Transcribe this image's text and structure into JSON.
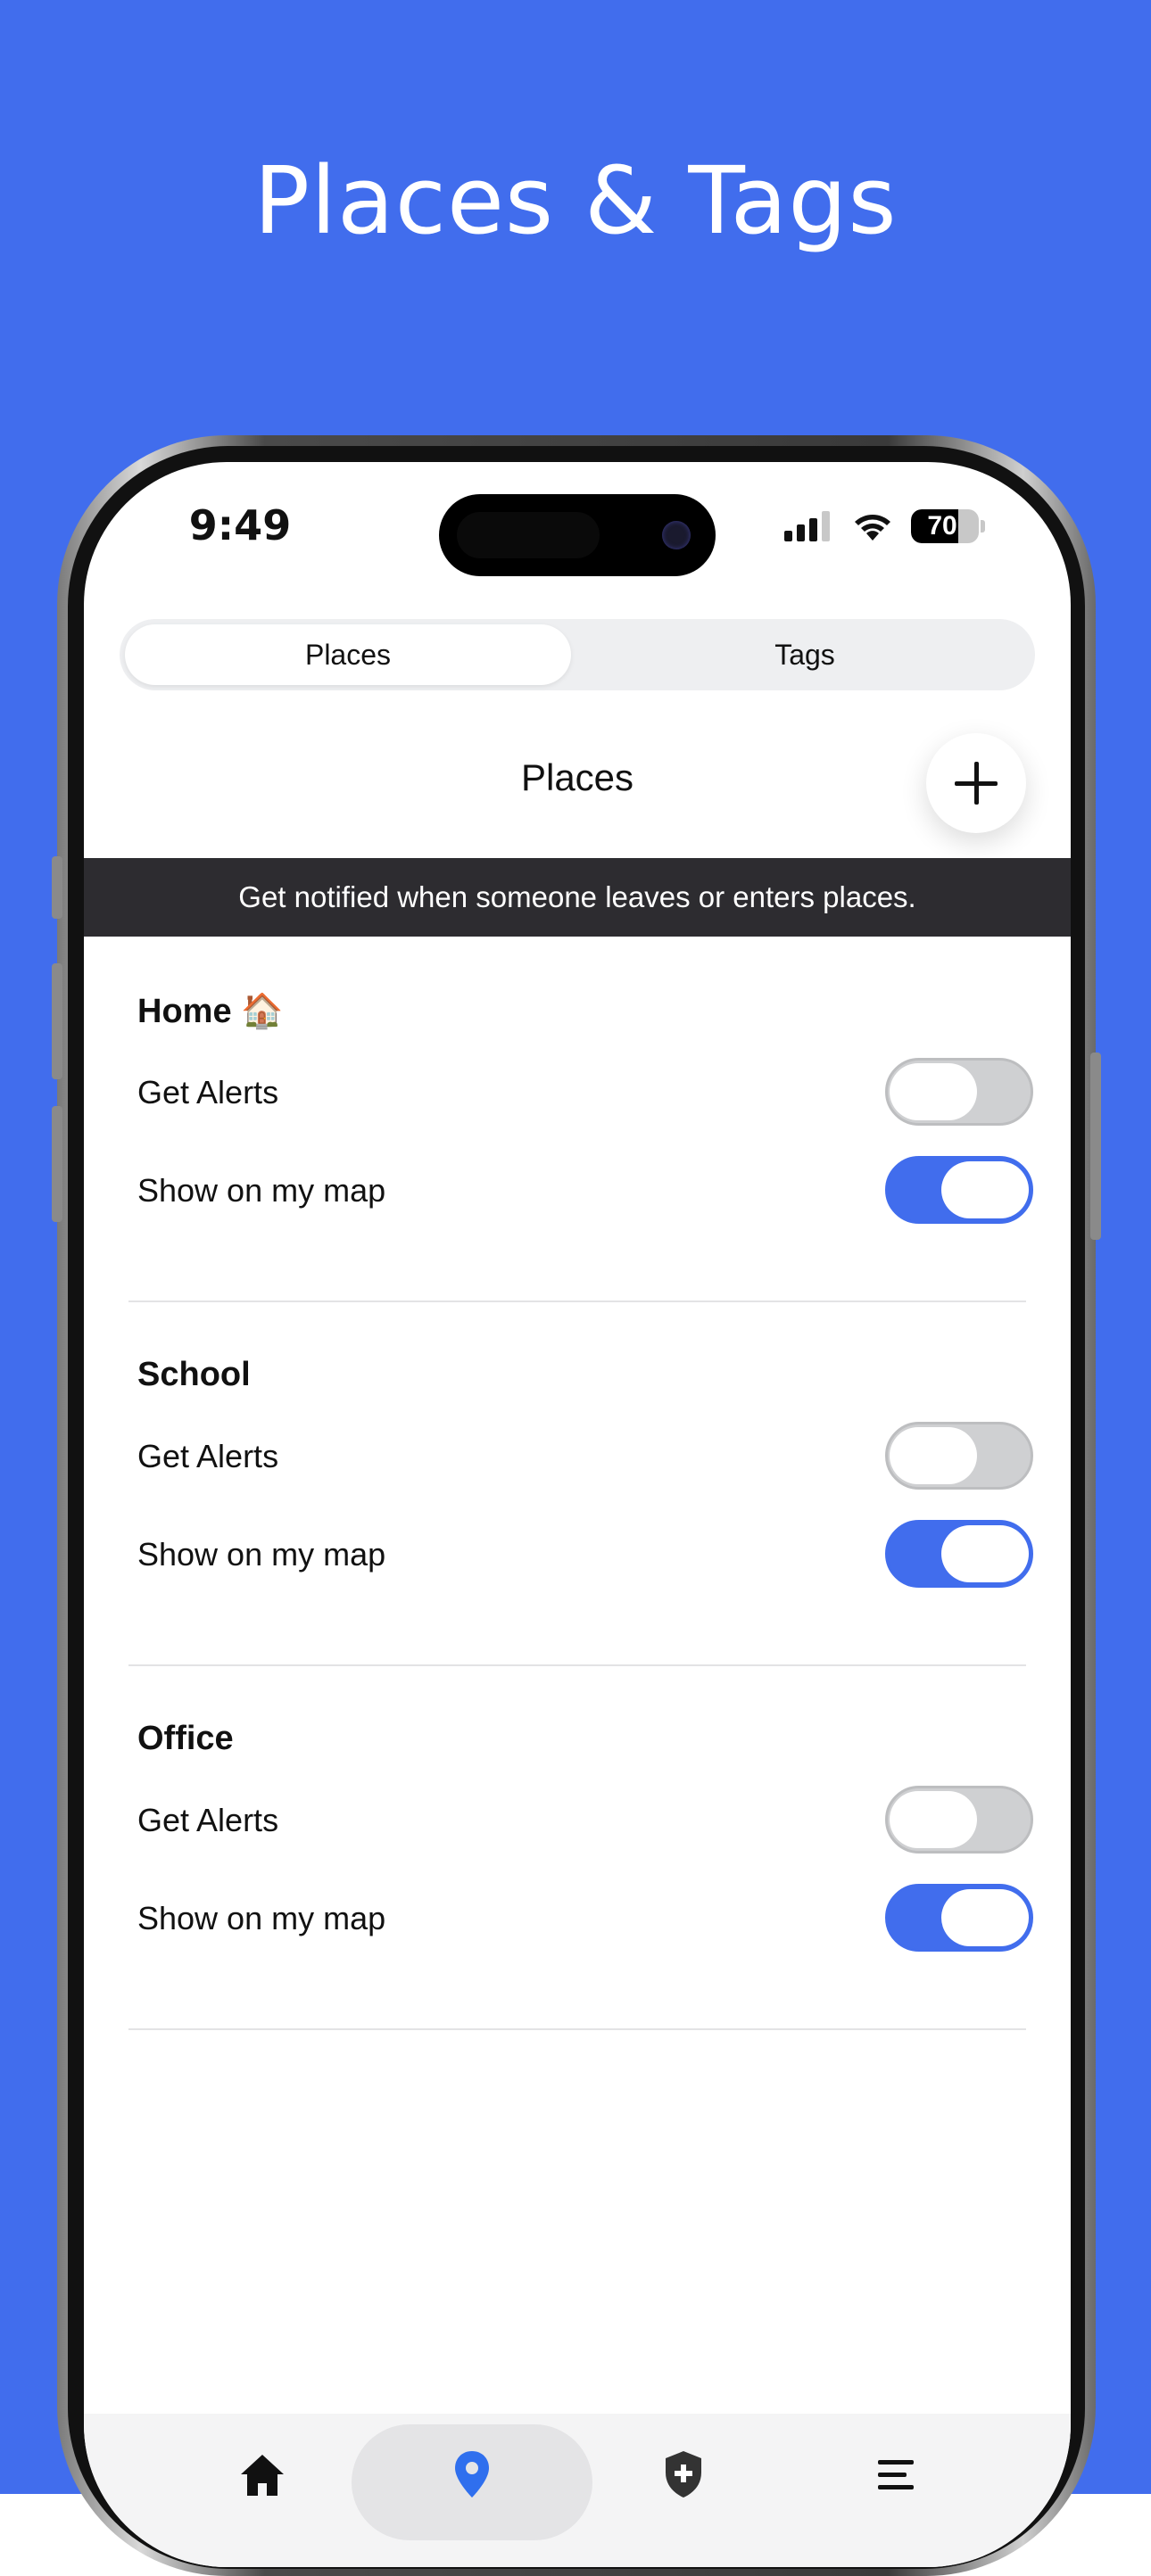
{
  "headline": "Places & Tags",
  "status_bar": {
    "time": "9:49",
    "battery_percent": "70",
    "battery_level": 0.7
  },
  "segmented": {
    "active": "Places",
    "inactive": "Tags"
  },
  "page_title": "Places",
  "add_button_icon": "plus-icon",
  "banner_text": "Get notified when someone leaves or enters places.",
  "places": [
    {
      "name": "Home 🏠",
      "alerts_label": "Get Alerts",
      "alerts_on": false,
      "map_label": "Show on my map",
      "map_on": true
    },
    {
      "name": "School",
      "alerts_label": "Get Alerts",
      "alerts_on": false,
      "map_label": "Show on my map",
      "map_on": true
    },
    {
      "name": "Office",
      "alerts_label": "Get Alerts",
      "alerts_on": false,
      "map_label": "Show on my map",
      "map_on": true
    }
  ],
  "bottom_nav": [
    {
      "icon": "home-icon",
      "active": false
    },
    {
      "icon": "location-pin-icon",
      "active": true
    },
    {
      "icon": "shield-plus-icon",
      "active": false
    },
    {
      "icon": "menu-icon",
      "active": false
    }
  ],
  "colors": {
    "brand_blue": "#416ded",
    "banner_bg": "#2d2c30",
    "toggle_off": "#cfd0d2",
    "pin_blue": "#2f6fee"
  }
}
